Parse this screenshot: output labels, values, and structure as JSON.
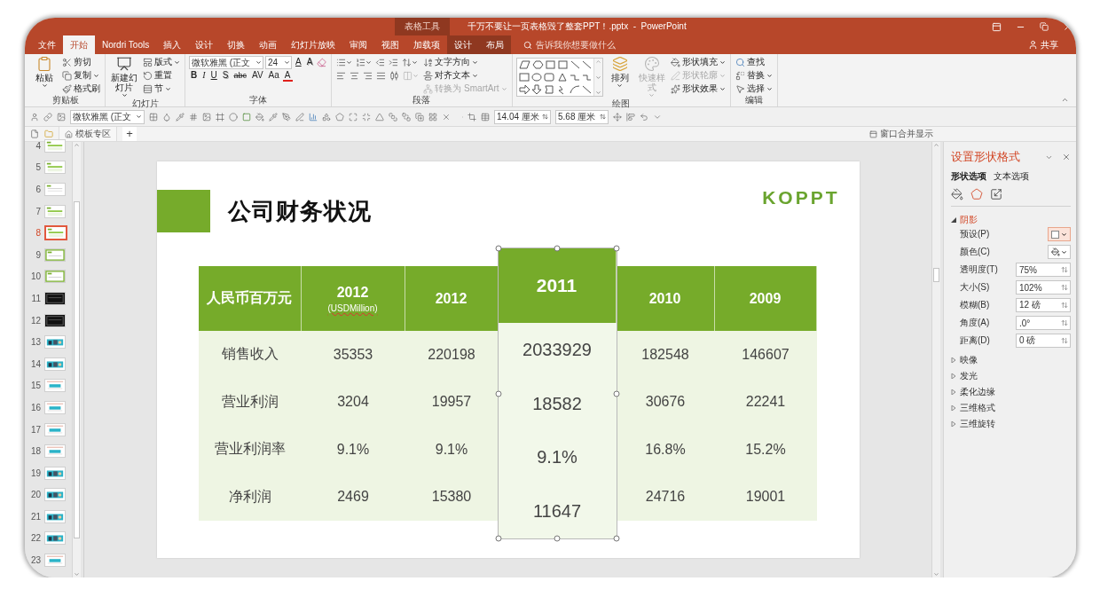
{
  "window": {
    "context_group": "表格工具",
    "title": "千万不要让一页表格毁了整套PPT！.pptx  -  PowerPoint"
  },
  "tabs": [
    {
      "label": "文件",
      "selected": false,
      "context": false
    },
    {
      "label": "开始",
      "selected": true,
      "context": false
    },
    {
      "label": "Nordri Tools",
      "selected": false,
      "context": false
    },
    {
      "label": "插入",
      "selected": false,
      "context": false
    },
    {
      "label": "设计",
      "selected": false,
      "context": false
    },
    {
      "label": "切换",
      "selected": false,
      "context": false
    },
    {
      "label": "动画",
      "selected": false,
      "context": false
    },
    {
      "label": "幻灯片放映",
      "selected": false,
      "context": false
    },
    {
      "label": "审阅",
      "selected": false,
      "context": false
    },
    {
      "label": "视图",
      "selected": false,
      "context": false
    },
    {
      "label": "加载项",
      "selected": false,
      "context": false
    },
    {
      "label": "设计",
      "selected": false,
      "context": true
    },
    {
      "label": "布局",
      "selected": false,
      "context": true
    }
  ],
  "tell_me": {
    "placeholder": "告诉我你想要做什么"
  },
  "share": "共享",
  "ribbon": [
    {
      "label": "剪贴板",
      "blocks": [
        {
          "kind": "large",
          "label": "粘贴",
          "dropdown": true,
          "disabled": false
        },
        {
          "kind": "stack",
          "lines": [
            {
              "items": [
                {
                  "kind": "button",
                  "label": "剪切",
                  "dropdown": false,
                  "disabled": false
                }
              ]
            },
            {
              "items": [
                {
                  "kind": "button",
                  "label": "复制",
                  "dropdown": true,
                  "disabled": false
                }
              ]
            },
            {
              "items": [
                {
                  "kind": "button",
                  "label": "格式刷",
                  "dropdown": false,
                  "disabled": false
                }
              ]
            }
          ]
        }
      ]
    },
    {
      "label": "幻灯片",
      "blocks": [
        {
          "kind": "large",
          "label": "新建幻灯片",
          "dropdown": true,
          "disabled": false
        },
        {
          "kind": "stack",
          "lines": [
            {
              "items": [
                {
                  "kind": "button",
                  "label": "版式",
                  "dropdown": true,
                  "disabled": false
                }
              ]
            },
            {
              "items": [
                {
                  "kind": "button",
                  "label": "重置",
                  "dropdown": false,
                  "disabled": false
                }
              ]
            },
            {
              "items": [
                {
                  "kind": "button",
                  "label": "节",
                  "dropdown": true,
                  "disabled": false
                }
              ]
            }
          ]
        }
      ]
    },
    {
      "label": "字体",
      "blocks": [
        {
          "kind": "stack",
          "lines": [
            {
              "items": [
                {
                  "kind": "field",
                  "value": "微软雅黑 (正文"
                },
                {
                  "kind": "field",
                  "value": "24"
                },
                {
                  "kind": "glyph",
                  "label": "A"
                },
                {
                  "kind": "glyph",
                  "label": "A"
                },
                {
                  "kind": "icon",
                  "dropdown": false,
                  "disabled": false
                }
              ]
            },
            {
              "items": [
                {
                  "kind": "glyph",
                  "label": "B"
                },
                {
                  "kind": "glyph",
                  "label": "I"
                },
                {
                  "kind": "glyph",
                  "label": "U"
                },
                {
                  "kind": "glyph",
                  "label": "S"
                },
                {
                  "kind": "glyph",
                  "label": "abc"
                },
                {
                  "kind": "glyph",
                  "label": "AV"
                },
                {
                  "kind": "glyph",
                  "label": "Aa"
                },
                {
                  "kind": "glyph",
                  "label": "A"
                }
              ]
            }
          ]
        }
      ]
    },
    {
      "label": "段落",
      "blocks": [
        {
          "kind": "stack",
          "lines": [
            {
              "items": [
                {
                  "kind": "icon",
                  "dropdown": true,
                  "disabled": false
                },
                {
                  "kind": "icon",
                  "dropdown": true,
                  "disabled": false
                },
                {
                  "kind": "icon",
                  "dropdown": false,
                  "disabled": false
                },
                {
                  "kind": "icon",
                  "dropdown": false,
                  "disabled": false
                },
                {
                  "kind": "icon",
                  "dropdown": true,
                  "disabled": false
                }
              ]
            },
            {
              "items": [
                {
                  "kind": "icon",
                  "dropdown": false,
                  "disabled": false
                },
                {
                  "kind": "icon",
                  "dropdown": false,
                  "disabled": false
                },
                {
                  "kind": "icon",
                  "dropdown": false,
                  "disabled": false
                },
                {
                  "kind": "icon",
                  "dropdown": false,
                  "disabled": false
                },
                {
                  "kind": "icon",
                  "dropdown": false,
                  "disabled": false
                },
                {
                  "kind": "icon",
                  "dropdown": true,
                  "disabled": true
                }
              ]
            }
          ]
        },
        {
          "kind": "stack",
          "lines": [
            {
              "items": [
                {
                  "kind": "button",
                  "label": "文字方向",
                  "dropdown": true,
                  "disabled": false
                }
              ]
            },
            {
              "items": [
                {
                  "kind": "button",
                  "label": "对齐文本",
                  "dropdown": true,
                  "disabled": false
                }
              ]
            },
            {
              "items": [
                {
                  "kind": "button",
                  "label": "转换为 SmartArt",
                  "dropdown": true,
                  "disabled": true
                }
              ]
            }
          ]
        }
      ]
    },
    {
      "label": "绘图",
      "blocks": [
        {
          "kind": "gallery"
        },
        {
          "kind": "large",
          "label": "排列",
          "dropdown": true,
          "disabled": false
        },
        {
          "kind": "large",
          "label": "快速样式",
          "dropdown": true,
          "disabled": true
        },
        {
          "kind": "stack",
          "lines": [
            {
              "items": [
                {
                  "kind": "button",
                  "label": "形状填充",
                  "dropdown": true,
                  "disabled": false
                }
              ]
            },
            {
              "items": [
                {
                  "kind": "button",
                  "label": "形状轮廓",
                  "dropdown": true,
                  "disabled": true
                }
              ]
            },
            {
              "items": [
                {
                  "kind": "button",
                  "label": "形状效果",
                  "dropdown": true,
                  "disabled": false
                }
              ]
            }
          ]
        }
      ]
    },
    {
      "label": "编辑",
      "blocks": [
        {
          "kind": "stack",
          "lines": [
            {
              "items": [
                {
                  "kind": "button",
                  "label": "查找",
                  "dropdown": false,
                  "disabled": false
                }
              ]
            },
            {
              "items": [
                {
                  "kind": "button",
                  "label": "替换",
                  "dropdown": true,
                  "disabled": false
                }
              ]
            },
            {
              "items": [
                {
                  "kind": "button",
                  "label": "选择",
                  "dropdown": true,
                  "disabled": false
                }
              ]
            }
          ]
        }
      ]
    }
  ],
  "quick_toolbar": {
    "font": "微软雅黑 (正文",
    "width": "14.04 厘米",
    "height": "5.68 厘米"
  },
  "doc_bar": {
    "template_tab": "模板专区",
    "add": "+",
    "merge": "窗口合并显示"
  },
  "thumbnails": [
    {
      "number": "4",
      "selected": false,
      "kind": "green"
    },
    {
      "number": "5",
      "selected": false,
      "kind": "green"
    },
    {
      "number": "6",
      "selected": false,
      "kind": "plain"
    },
    {
      "number": "7",
      "selected": false,
      "kind": "green"
    },
    {
      "number": "8",
      "selected": true,
      "kind": "green"
    },
    {
      "number": "9",
      "selected": false,
      "kind": "framed"
    },
    {
      "number": "10",
      "selected": false,
      "kind": "framed"
    },
    {
      "number": "11",
      "selected": false,
      "kind": "dark"
    },
    {
      "number": "12",
      "selected": false,
      "kind": "dark"
    },
    {
      "number": "13",
      "selected": false
    },
    {
      "number": "14",
      "selected": false
    },
    {
      "number": "15",
      "selected": false,
      "kind": "cyan"
    },
    {
      "number": "16",
      "selected": false,
      "kind": "cyan"
    },
    {
      "number": "17",
      "selected": false,
      "kind": "cyan"
    },
    {
      "number": "18",
      "selected": false,
      "kind": "cyan"
    },
    {
      "number": "19",
      "selected": false
    },
    {
      "number": "20",
      "selected": false
    },
    {
      "number": "21",
      "selected": false
    },
    {
      "number": "22",
      "selected": false
    },
    {
      "number": "23",
      "selected": false,
      "kind": "cyan"
    }
  ],
  "slide": {
    "title": "公司财务状况",
    "logo": "KOPPT",
    "table": {
      "columns": [
        {
          "header": "人民币百万元",
          "selected": false
        },
        {
          "header": "2012",
          "subheader": "(USDMillion)",
          "selected": false
        },
        {
          "header": "2012",
          "selected": false
        },
        {
          "header": "2011",
          "selected": true
        },
        {
          "header": "2010",
          "selected": false
        },
        {
          "header": "2009",
          "selected": false
        }
      ],
      "rows": [
        [
          "销售收入",
          "35353",
          "220198",
          "2033929",
          "182548",
          "146607"
        ],
        [
          "营业利润",
          "3204",
          "19957",
          "18582",
          "30676",
          "22241"
        ],
        [
          "营业利润率",
          "9.1%",
          "9.1%",
          "9.1%",
          "16.8%",
          "15.2%"
        ],
        [
          "净利润",
          "2469",
          "15380",
          "11647",
          "24716",
          "19001"
        ]
      ]
    }
  },
  "format_pane": {
    "title": "设置形状格式",
    "tabs": [
      {
        "label": "形状选项",
        "selected": true
      },
      {
        "label": "文本选项",
        "selected": false
      }
    ],
    "icon_tabs": [
      {
        "selected": false
      },
      {
        "selected": true
      },
      {
        "selected": false
      }
    ],
    "sections": [
      {
        "label": "阴影",
        "expanded": true,
        "properties": [
          {
            "kind": "preset",
            "label": "预设(P)"
          },
          {
            "kind": "color",
            "label": "颜色(C)"
          },
          {
            "kind": "spin",
            "label": "透明度(T)",
            "value": "75%"
          },
          {
            "kind": "spin",
            "label": "大小(S)",
            "value": "102%"
          },
          {
            "kind": "spin",
            "label": "模糊(B)",
            "value": "12 磅"
          },
          {
            "kind": "spin",
            "label": "角度(A)",
            "value": ".0°"
          },
          {
            "kind": "spin",
            "label": "距离(D)",
            "value": "0 磅"
          }
        ]
      },
      {
        "label": "映像",
        "expanded": false
      },
      {
        "label": "发光",
        "expanded": false
      },
      {
        "label": "柔化边缘",
        "expanded": false
      },
      {
        "label": "三维格式",
        "expanded": false
      },
      {
        "label": "三维旋转",
        "expanded": false
      }
    ]
  }
}
